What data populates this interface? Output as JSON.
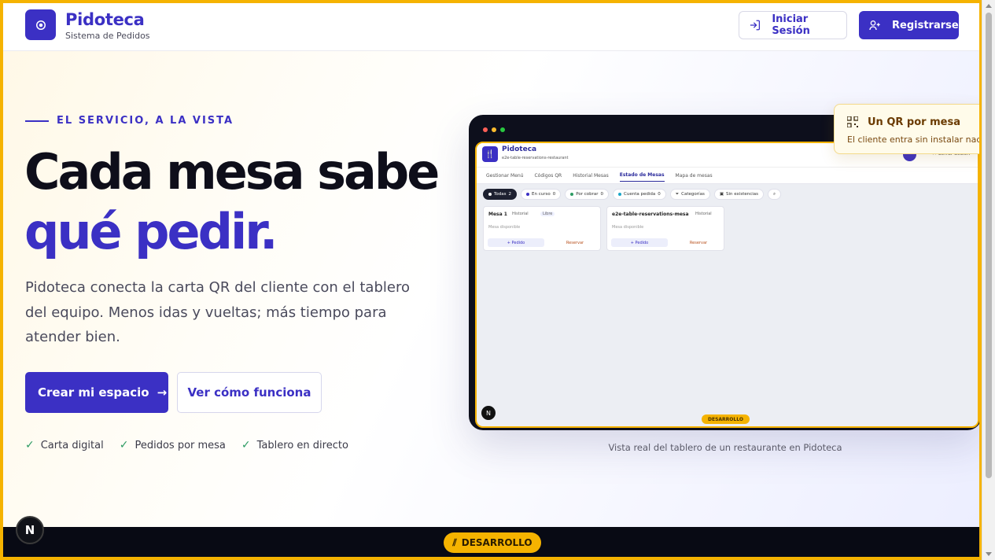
{
  "header": {
    "brand": "Pidoteca",
    "brand_sub": "Sistema de Pedidos",
    "login_label": "Iniciar Sesión",
    "register_label": "Registrarse"
  },
  "hero": {
    "eyebrow": "EL SERVICIO, A LA VISTA",
    "title_line1": "Cada mesa sabe",
    "title_line2": "qué pedir.",
    "lead": "Pidoteca conecta la carta QR del cliente con el tablero del equipo. Menos idas y vueltas; más tiempo para atender bien.",
    "cta_primary": "Crear mi espacio",
    "cta_secondary": "Ver cómo funciona",
    "features": [
      "Carta digital",
      "Pedidos por mesa",
      "Tablero en directo"
    ]
  },
  "preview": {
    "app_name": "Pidoteca",
    "app_sub": "e2e-table-reservations-restaurant",
    "logout": "Cerrar Sesión",
    "tabs": [
      "Gestionar Menú",
      "Códigos QR",
      "Historial Mesas",
      "Estado de Mesas",
      "Mapa de mesas"
    ],
    "active_tab": "Estado de Mesas",
    "filters": [
      {
        "label": "Todas",
        "count": "2",
        "color": "#ffffff"
      },
      {
        "label": "En curso",
        "count": "0",
        "color": "#3b30c4"
      },
      {
        "label": "Por cobrar",
        "count": "0",
        "color": "#2d9b63"
      },
      {
        "label": "Cuenta pedida",
        "count": "0",
        "color": "#1aa6c9"
      },
      {
        "label": "Categorías",
        "count": "",
        "color": ""
      },
      {
        "label": "Sin existencias",
        "count": "",
        "color": ""
      }
    ],
    "cards": [
      {
        "title": "Mesa 1",
        "history": "Historial",
        "badge": "Libre",
        "status": "Mesa disponible",
        "btn1": "+ Pedido",
        "btn2": "Reservar"
      },
      {
        "title": "e2e-table-reservations-mesa",
        "history": "Historial",
        "badge": "",
        "status": "Mesa disponible",
        "btn1": "+ Pedido",
        "btn2": "Reservar"
      }
    ],
    "dev_label": "DESARROLLO",
    "caption": "Vista real del tablero de un restaurante en Pidoteca"
  },
  "qr_tip": {
    "title": "Un QR por mesa",
    "desc": "El cliente entra sin instalar nado."
  },
  "dev_bar": {
    "label": "DESARROLLO",
    "n_badge": "N"
  },
  "colors": {
    "accent": "#3b30c4",
    "warning": "#f5b300",
    "success": "#2d9b63"
  }
}
